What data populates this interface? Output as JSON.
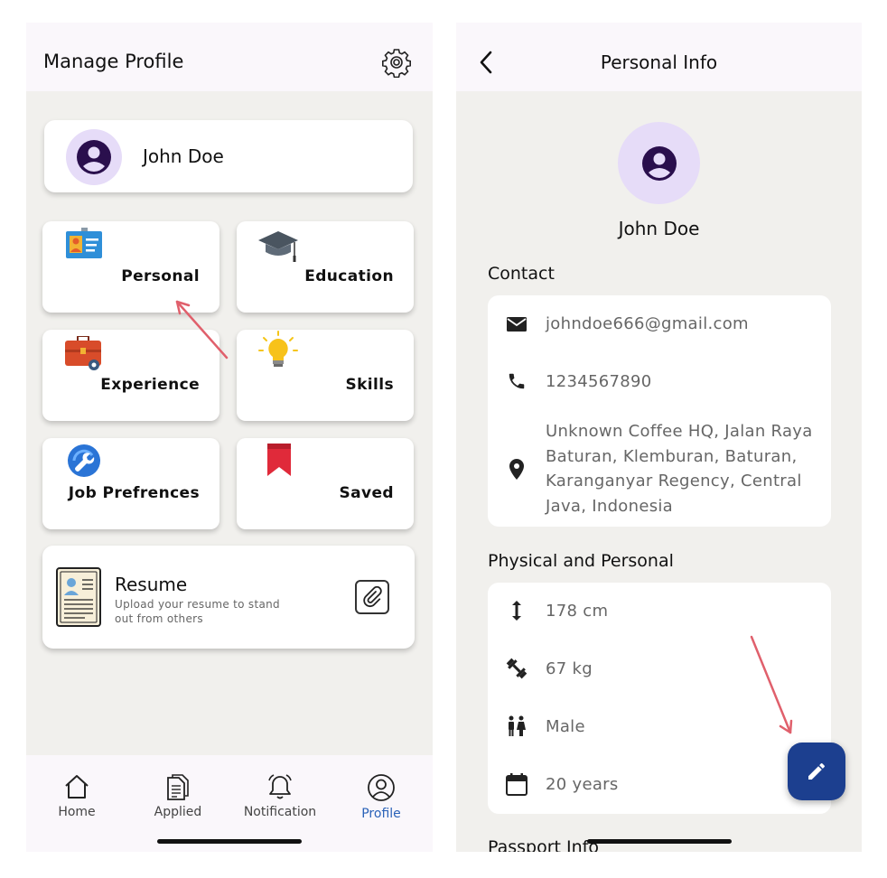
{
  "left": {
    "header": {
      "title": "Manage Profile",
      "settings_icon": "gear-icon"
    },
    "profile_card": {
      "name": "John Doe",
      "avatar_icon": "account-circle-icon"
    },
    "tiles": [
      {
        "label": "Personal",
        "icon": "id-card-icon"
      },
      {
        "label": "Education",
        "icon": "graduation-cap-icon"
      },
      {
        "label": "Experience",
        "icon": "briefcase-gear-icon"
      },
      {
        "label": "Skills",
        "icon": "lightbulb-icon"
      },
      {
        "label": "Job Prefrences",
        "icon": "wrench-circle-icon"
      },
      {
        "label": "Saved",
        "icon": "bookmark-icon"
      }
    ],
    "resume": {
      "title": "Resume",
      "subtitle": "Upload your resume to stand out from others",
      "attach_icon": "paperclip-icon"
    },
    "bottom_nav": [
      {
        "label": "Home",
        "icon": "home-icon",
        "active": false
      },
      {
        "label": "Applied",
        "icon": "document-icon",
        "active": false
      },
      {
        "label": "Notification",
        "icon": "bell-icon",
        "active": false
      },
      {
        "label": "Profile",
        "icon": "profile-icon",
        "active": true
      }
    ],
    "active_color": "#2a62b8"
  },
  "right": {
    "header": {
      "title": "Personal Info",
      "back_icon": "chevron-left-icon"
    },
    "profile": {
      "name": "John Doe",
      "avatar_icon": "account-circle-icon"
    },
    "contact": {
      "title": "Contact",
      "email": "johndoe666@gmail.com",
      "phone": "1234567890",
      "address": "Unknown Coffee HQ, Jalan Raya Baturan, Klemburan, Baturan, Karanganyar Regency, Central Java, Indonesia"
    },
    "physical": {
      "title": "Physical and Personal",
      "height": "178 cm",
      "weight": "67 kg",
      "gender": "Male",
      "age": "20 years"
    },
    "passport": {
      "title": "Passport Info"
    },
    "fab_icon": "pencil-icon",
    "fab_color": "#1c3f8f"
  },
  "colors": {
    "avatar_bg": "#e6dcf8",
    "avatar_fg": "#2a0f4d",
    "annotation_arrow": "#e0606c"
  }
}
